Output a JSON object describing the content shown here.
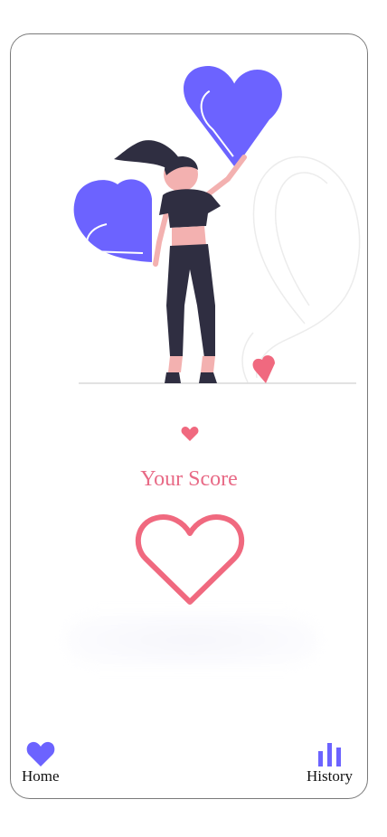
{
  "main": {
    "score_label": "Your Score",
    "score_value": ""
  },
  "nav": {
    "items": [
      {
        "label": "Home",
        "icon": "heart-icon"
      },
      {
        "label": "History",
        "icon": "bar-chart-icon"
      }
    ]
  },
  "colors": {
    "accent": "#6c63ff",
    "score": "#f0697f",
    "dark": "#2f2e41"
  }
}
